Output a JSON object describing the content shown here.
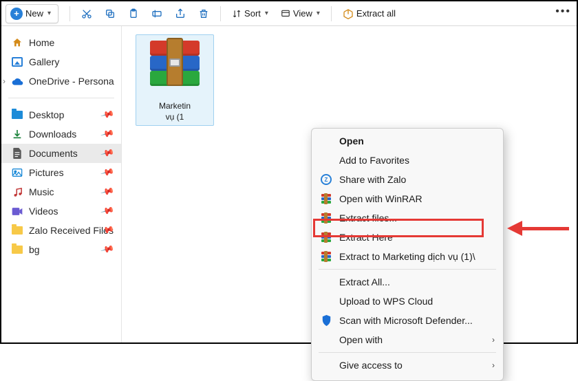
{
  "toolbar": {
    "new_label": "New",
    "sort_label": "Sort",
    "view_label": "View",
    "extract_all_label": "Extract all"
  },
  "sidebar": {
    "top": [
      {
        "label": "Home",
        "icon": "home"
      },
      {
        "label": "Gallery",
        "icon": "gallery"
      },
      {
        "label": "OneDrive - Persona",
        "icon": "cloud",
        "expandable": true
      }
    ],
    "pinned": [
      {
        "label": "Desktop",
        "icon": "desktop",
        "pinned": true
      },
      {
        "label": "Downloads",
        "icon": "download",
        "pinned": true
      },
      {
        "label": "Documents",
        "icon": "doc",
        "pinned": true,
        "selected": true
      },
      {
        "label": "Pictures",
        "icon": "pic",
        "pinned": true
      },
      {
        "label": "Music",
        "icon": "music",
        "pinned": true
      },
      {
        "label": "Videos",
        "icon": "video",
        "pinned": true
      },
      {
        "label": "Zalo Received Files",
        "icon": "folder",
        "pinned": true
      },
      {
        "label": "bg",
        "icon": "folder",
        "pinned": true
      }
    ]
  },
  "file": {
    "name": "Marketin\nvụ (1"
  },
  "context_menu": {
    "items": [
      {
        "label": "Open",
        "bold": true
      },
      {
        "label": "Add to Favorites"
      },
      {
        "label": "Share with Zalo",
        "icon": "zalo"
      },
      {
        "label": "Open with WinRAR",
        "icon": "rar"
      },
      {
        "label": "Extract files...",
        "icon": "rar"
      },
      {
        "label": "Extract Here",
        "icon": "rar",
        "highlighted": true
      },
      {
        "label": "Extract to Marketing dịch vụ (1)\\",
        "icon": "rar"
      },
      {
        "sep": true
      },
      {
        "label": "Extract All..."
      },
      {
        "label": "Upload to WPS Cloud"
      },
      {
        "label": "Scan with Microsoft Defender...",
        "icon": "shield"
      },
      {
        "label": "Open with",
        "submenu": true
      },
      {
        "sep": true
      },
      {
        "label": "Give access to",
        "submenu": true
      }
    ]
  }
}
